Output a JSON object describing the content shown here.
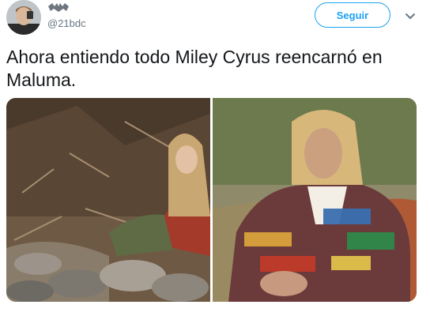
{
  "author": {
    "handle": "@21bdc",
    "avatar_icon": "profile-photo",
    "display_name_icon": "bat-emblem-icon"
  },
  "actions": {
    "follow_label": "Seguir",
    "more_icon": "chevron-down-icon"
  },
  "tweet": {
    "text": "Ahora entiendo todo Miley Cyrus reencarnó en Maluma."
  },
  "media": {
    "photos": [
      {
        "name": "photo-left",
        "icon": "woman-on-rocks-photo"
      },
      {
        "name": "photo-right",
        "icon": "man-in-knit-sweater-photo"
      }
    ]
  },
  "colors": {
    "accent": "#1da1f2",
    "text": "#14171a",
    "secondary": "#657786"
  }
}
